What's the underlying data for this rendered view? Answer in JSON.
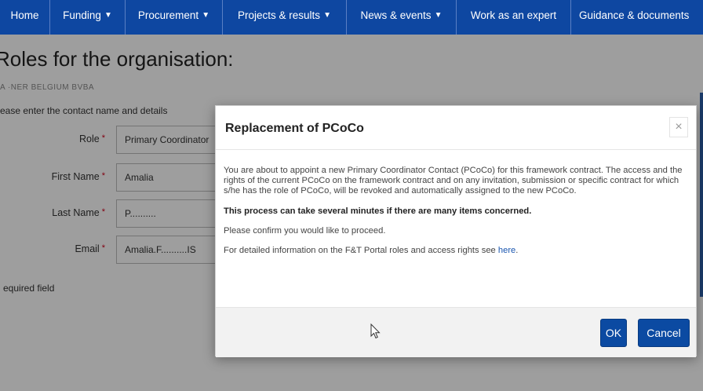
{
  "nav": {
    "items": [
      {
        "label": "Home",
        "caret": false
      },
      {
        "label": "Funding",
        "caret": true
      },
      {
        "label": "Procurement",
        "caret": true
      },
      {
        "label": "Projects & results",
        "caret": true
      },
      {
        "label": "News & events",
        "caret": true
      },
      {
        "label": "Work as an expert",
        "caret": false
      },
      {
        "label": "Guidance & documents",
        "caret": false
      }
    ],
    "caret_glyph": "▼",
    "background": "#0e47a1"
  },
  "page": {
    "title": "Roles for the organisation:",
    "org_name": "A ·NER BELGIUM BVBA",
    "instruction": "ease enter the contact name and details",
    "required_note": "equired field",
    "form": {
      "role_label": "Role",
      "role_value": "Primary Coordinator",
      "first_name_label": "First Name",
      "first_name_value": "Amalia",
      "last_name_label": "Last Name",
      "last_name_value": "P..........",
      "email_label": "Email",
      "email_value": "Amalia.F..........IS",
      "required_marker": "*"
    }
  },
  "modal": {
    "title": "Replacement of PCoCo",
    "close_glyph": "×",
    "paragraph1": "You are about to appoint a new Primary Coordinator Contact (PCoCo) for this framework contract. The access and the rights of the current PCoCo on the framework contract and on any invitation, submission or specific contract for which s/he has the role of PCoCo, will be revoked and automatically assigned to the new PCoCo.",
    "paragraph2": "This process can take several minutes if there are many items concerned.",
    "paragraph3": "Please confirm you would like to proceed.",
    "paragraph4_prefix": "For detailed information on the F&T Portal roles and access rights see ",
    "paragraph4_link": "here",
    "paragraph4_suffix": ".",
    "ok_label": "OK",
    "cancel_label": "Cancel",
    "button_color": "#0b4aa2"
  }
}
